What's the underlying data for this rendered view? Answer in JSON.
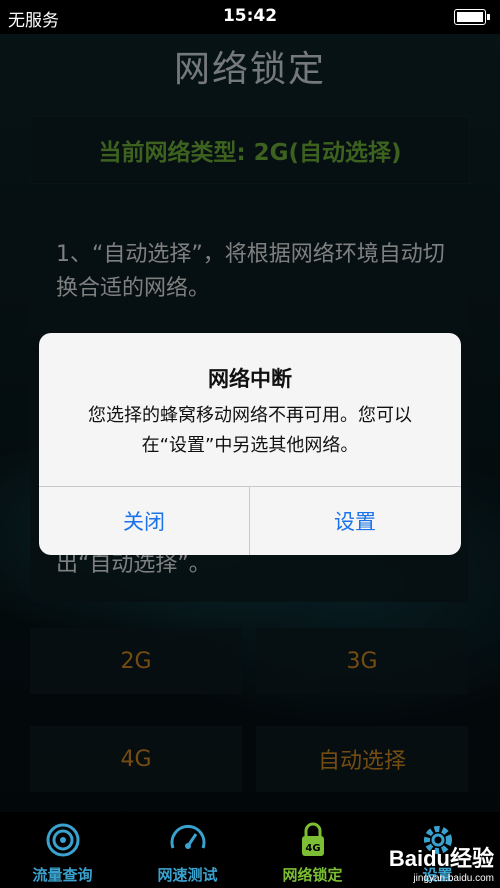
{
  "status_bar": {
    "carrier": "无服务",
    "time": "15:42"
  },
  "page": {
    "title": "网络锁定",
    "network_type": "当前网络类型: 2G(自动选择)",
    "info_text_1": "1、“自动选择”，将根据网络环境自动切换合适的网络。",
    "info_text_2": "出“自动选择”。"
  },
  "network_buttons": [
    "2G",
    "3G",
    "4G",
    "自动选择"
  ],
  "dialog": {
    "title": "网络中断",
    "message": "您选择的蜂窝移动网络不再可用。您可以在“设置”中另选其他网络。",
    "close_label": "关闭",
    "settings_label": "设置"
  },
  "tab_bar": {
    "items": [
      {
        "label": "流量查询",
        "icon": "traffic-query-icon"
      },
      {
        "label": "网速测试",
        "icon": "speedometer-icon"
      },
      {
        "label": "网络锁定",
        "icon": "lock-4g-icon",
        "active": true
      },
      {
        "label": "设置",
        "icon": "gear-icon"
      }
    ]
  },
  "watermark": {
    "brand": "Baidu经验",
    "url": "jingyan.baidu.com"
  },
  "colors": {
    "accent_green": "#7cbf34",
    "accent_blue": "#3aa2cf",
    "network_button_text": "#d38b22",
    "dialog_button_text": "#1a73e8"
  }
}
